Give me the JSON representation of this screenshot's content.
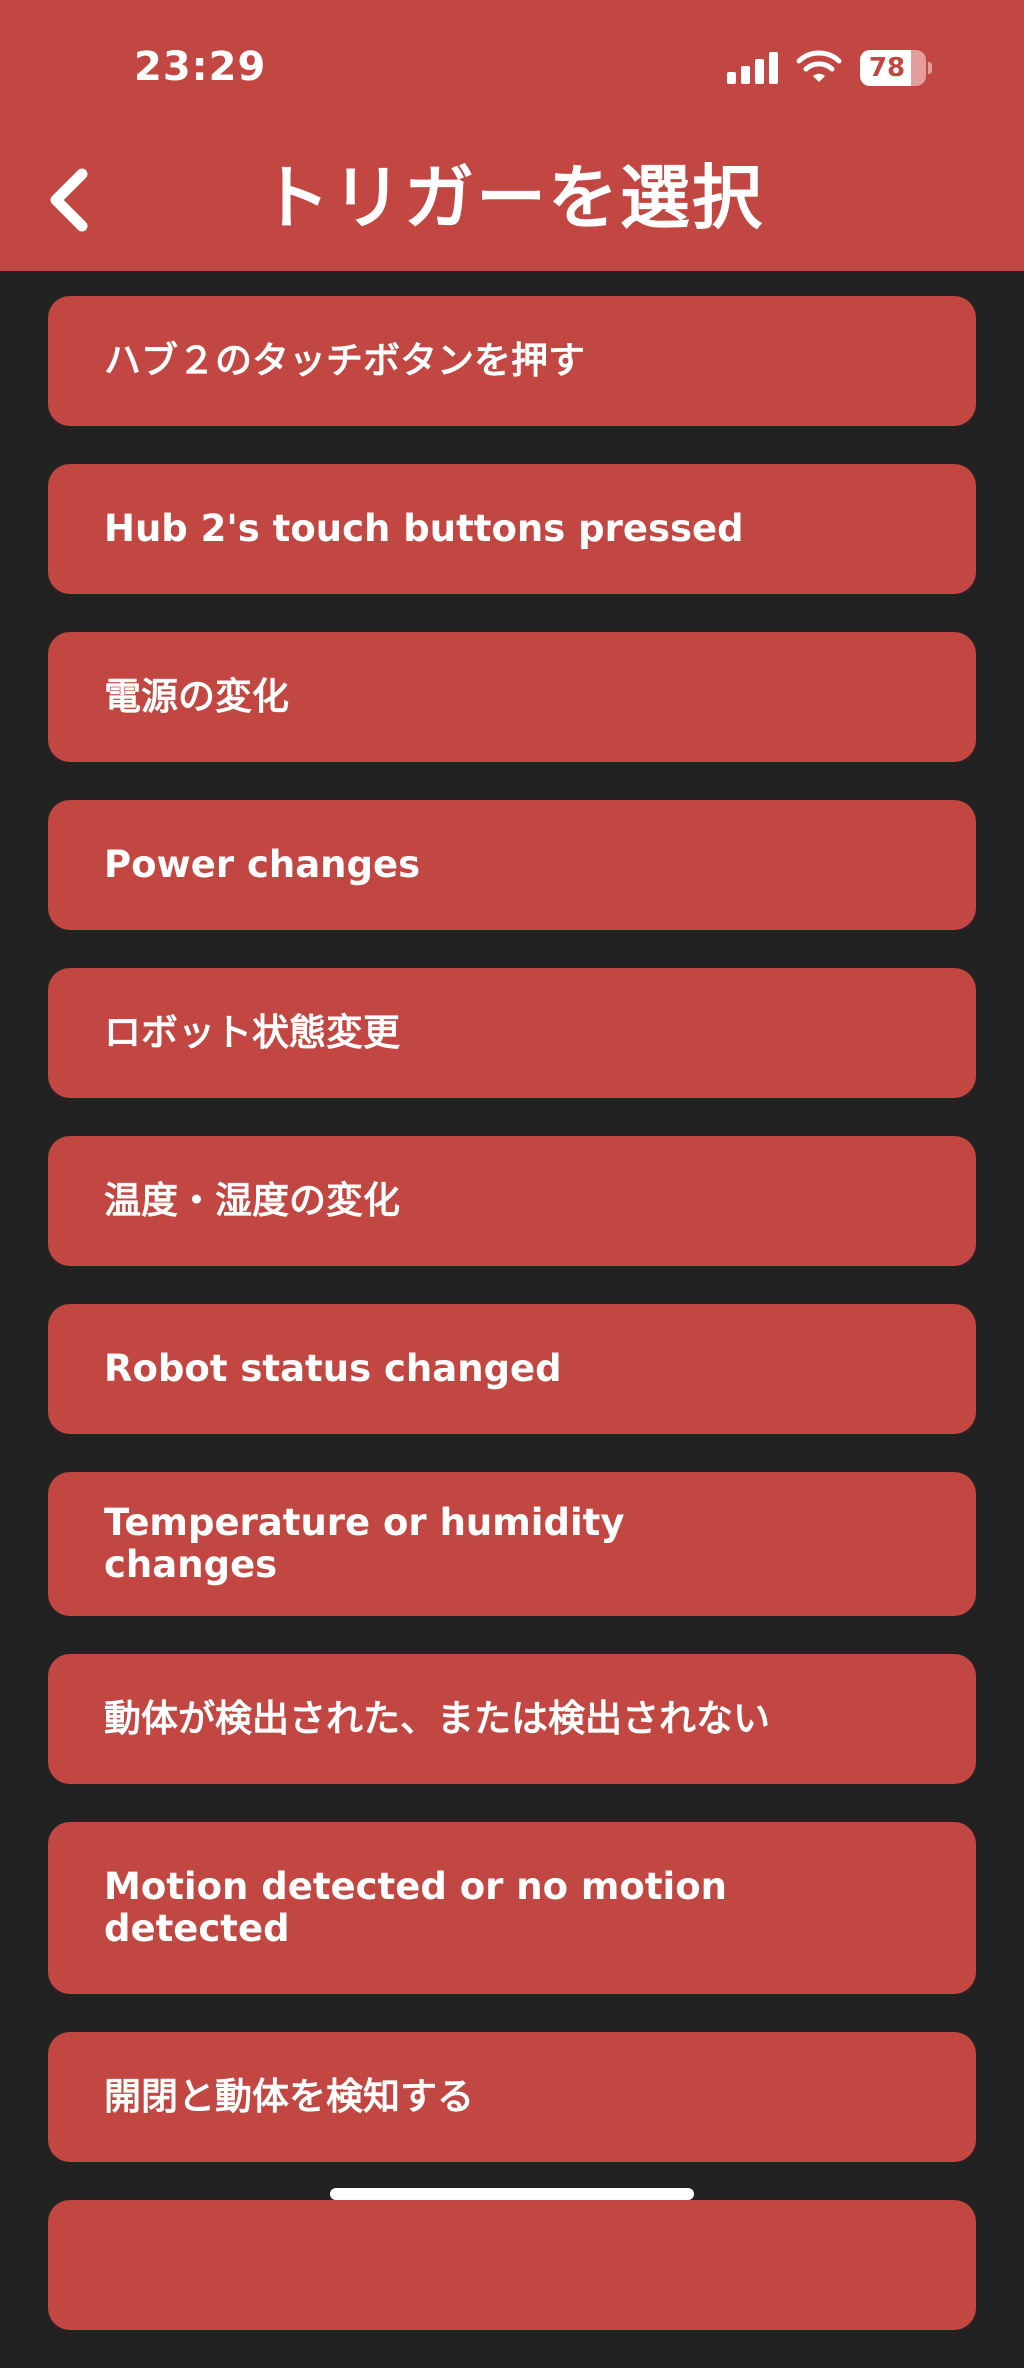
{
  "status_bar": {
    "time": "23:29",
    "battery": "78",
    "battery_level": 0.78,
    "icons": [
      "cellular-signal-icon",
      "wifi-icon",
      "battery-icon"
    ]
  },
  "header": {
    "title": "トリガーを選択",
    "back_icon": "chevron-left-icon"
  },
  "triggers": [
    {
      "label": "ハブ２のタッチボタンを押す"
    },
    {
      "label": "Hub 2's touch buttons pressed"
    },
    {
      "label": "電源の変化"
    },
    {
      "label": "Power changes"
    },
    {
      "label": "ロボット状態変更"
    },
    {
      "label": "温度・湿度の変化"
    },
    {
      "label": "Robot status changed"
    },
    {
      "label": "Temperature or humidity changes"
    },
    {
      "label": "動体が検出された、または検出されない"
    },
    {
      "label": "Motion detected or no motion detected"
    },
    {
      "label": "開閉と動体を検知する"
    },
    {
      "label": ""
    }
  ],
  "colors": {
    "accent": "#c24641",
    "background": "#222222",
    "text": "#ffffff"
  }
}
